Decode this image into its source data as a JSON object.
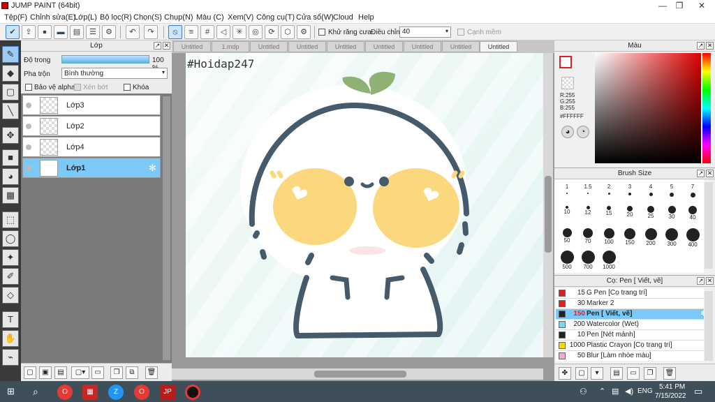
{
  "app": {
    "title": "JUMP PAINT (64bit)"
  },
  "window": {
    "min": "—",
    "max": "❐",
    "close": "✕"
  },
  "menu": [
    "Tệp(F)",
    "Chỉnh sửa(E)",
    "Lớp(L)",
    "Bộ lọc(R)",
    "Chọn(S)",
    "Chụp(N)",
    "Màu (C)",
    "Xem(V)",
    "Công cụ(T)",
    "Cửa sổ(W)",
    "Cloud",
    "Help"
  ],
  "toolbar": {
    "antialias_label": "Khử răng cưa",
    "adjust_label": "Điều chỉnh",
    "adjust_value": "40",
    "edge_label": "Cạnh mềm"
  },
  "layer_panel": {
    "title": "Lớp",
    "opacity_label": "Độ trong",
    "opacity_value": "100 %",
    "blend_label": "Pha trộn",
    "blend_value": "Bình thường",
    "protect_alpha": "Bảo vệ alpha",
    "clip": "Xén bớt",
    "lock": "Khóa",
    "layers": [
      {
        "name": "Lớp3"
      },
      {
        "name": "Lớp2"
      },
      {
        "name": "Lớp4"
      },
      {
        "name": "Lớp1"
      }
    ]
  },
  "tabs": [
    "Untitled",
    "1.mdp",
    "Untitled",
    "Untitled",
    "Untitled",
    "Untitled",
    "Untitled",
    "Untitled",
    "Untitled"
  ],
  "canvas": {
    "watermark": "#Hoidap247"
  },
  "color_panel": {
    "title": "Màu",
    "r": "R:255",
    "g": "G:255",
    "b": "B:255",
    "hex": "#FFFFFF"
  },
  "brush_size_panel": {
    "title": "Brush Size",
    "sizes": [
      "1",
      "1.5",
      "2",
      "3",
      "4",
      "5",
      "7",
      "10",
      "12",
      "15",
      "20",
      "25",
      "30",
      "40",
      "50",
      "70",
      "100",
      "150",
      "200",
      "300",
      "400",
      "500",
      "700",
      "1000"
    ]
  },
  "brush_panel": {
    "title": "Cọ: Pen [ Viết, vẽ]",
    "items": [
      {
        "size": "15",
        "name": "G Pen [Cọ trang trí]",
        "color": "#e02020"
      },
      {
        "size": "30",
        "name": "Marker 2",
        "color": "#e02020"
      },
      {
        "size": "150",
        "name": "Pen [ Viết, vẽ]",
        "color": "#222222"
      },
      {
        "size": "200",
        "name": "Watercolor (Wet)",
        "color": "#7fd3f5"
      },
      {
        "size": "10",
        "name": "Pen [Nét mảnh]",
        "color": "#222222"
      },
      {
        "size": "1000",
        "name": "Plastic Crayon [Cọ trang trí]",
        "color": "#f5d800"
      },
      {
        "size": "50",
        "name": "Blur [Làm nhòe màu]",
        "color": "#f0a8d8"
      }
    ]
  },
  "taskbar": {
    "lang": "ENG",
    "time": "5:41 PM",
    "date": "7/15/2022"
  },
  "colors": {
    "accent": "#7cc8f6",
    "outline": "#455a6b",
    "cheek": "#fbd77d",
    "leaf": "#8fb174"
  }
}
